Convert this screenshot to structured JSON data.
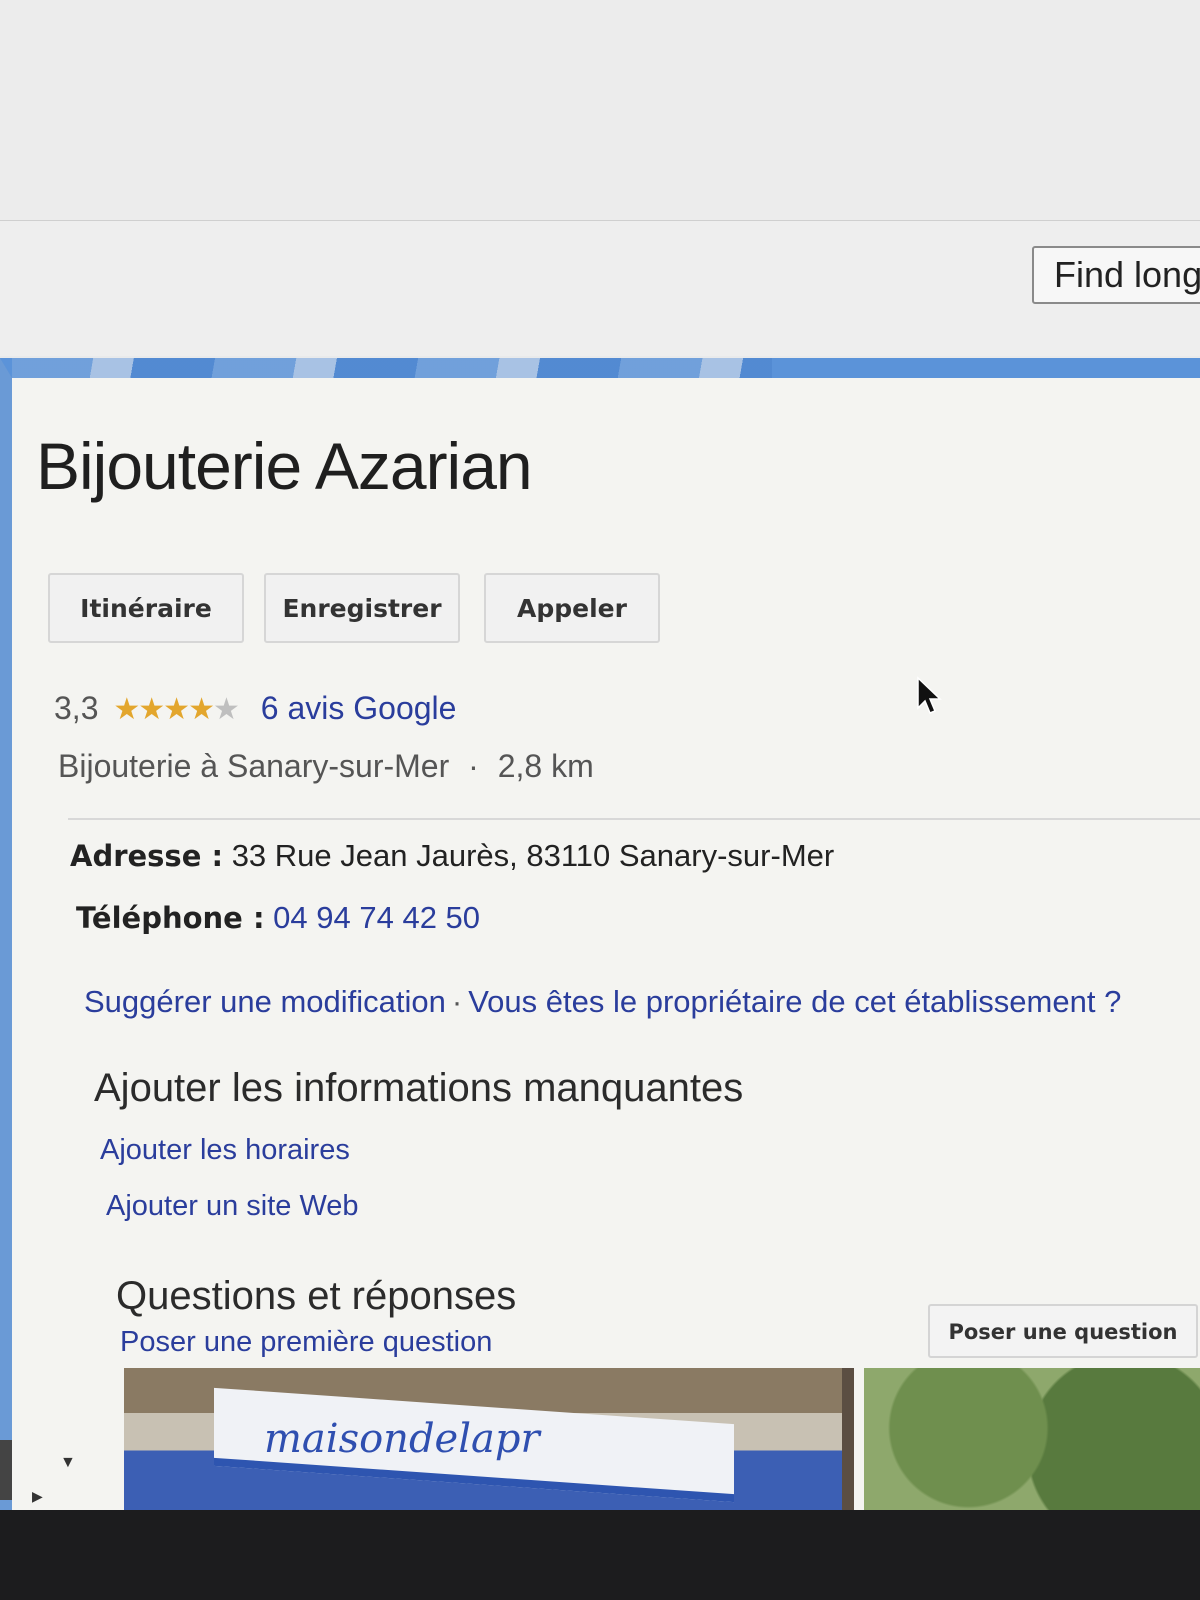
{
  "toolbar": {
    "find_button_label": "Find long"
  },
  "place": {
    "name": "Bijouterie Azarian",
    "actions": {
      "directions": "Itinéraire",
      "save": "Enregistrer",
      "call": "Appeler"
    },
    "rating": {
      "value_text": "3,3",
      "stars": 3.3,
      "max_stars": 5,
      "reviews_link": "6 avis Google"
    },
    "category": "Bijouterie à Sanary-sur-Mer",
    "separator": "·",
    "distance": "2,8 km",
    "address": {
      "label": "Adresse :",
      "value": "33 Rue Jean Jaurès, 83110 Sanary-sur-Mer"
    },
    "phone": {
      "label": "Téléphone :",
      "value": "04 94 74 42 50"
    },
    "suggest_edit": "Suggérer une modification",
    "owner_question": "Vous êtes le propriétaire de cet établissement ?"
  },
  "missing_info": {
    "title": "Ajouter les informations manquantes",
    "add_hours": "Ajouter les horaires",
    "add_website": "Ajouter un site Web"
  },
  "qa": {
    "title": "Questions et réponses",
    "first_question_link": "Poser une première question",
    "ask_button": "Poser une question"
  },
  "photos": {
    "store_sign": "maisondelapr"
  },
  "colors": {
    "link": "#2a3d9c",
    "star": "#e3a62d",
    "accent_bar": "#5b93d9"
  }
}
